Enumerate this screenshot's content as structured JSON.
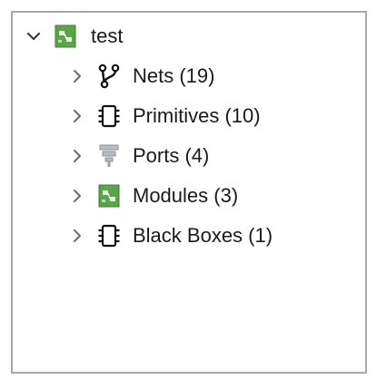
{
  "tree": {
    "root": {
      "label": "test",
      "icon": "module-chip-icon",
      "expanded": true
    },
    "children": [
      {
        "label": "Nets (19)",
        "icon": "net-fork-icon",
        "expanded": false
      },
      {
        "label": "Primitives (10)",
        "icon": "primitive-chip-icon",
        "expanded": false
      },
      {
        "label": "Ports (4)",
        "icon": "port-funnel-icon",
        "expanded": false
      },
      {
        "label": "Modules (3)",
        "icon": "module-chip-icon",
        "expanded": false
      },
      {
        "label": "Black Boxes (1)",
        "icon": "black-box-chip-icon",
        "expanded": false
      }
    ]
  },
  "colors": {
    "module_green": "#5aa547",
    "module_green_dark": "#3f7f33",
    "port_gray": "#9aa0a6",
    "chevron": "#6b6b6b",
    "panel_border": "#a8a8a8"
  }
}
